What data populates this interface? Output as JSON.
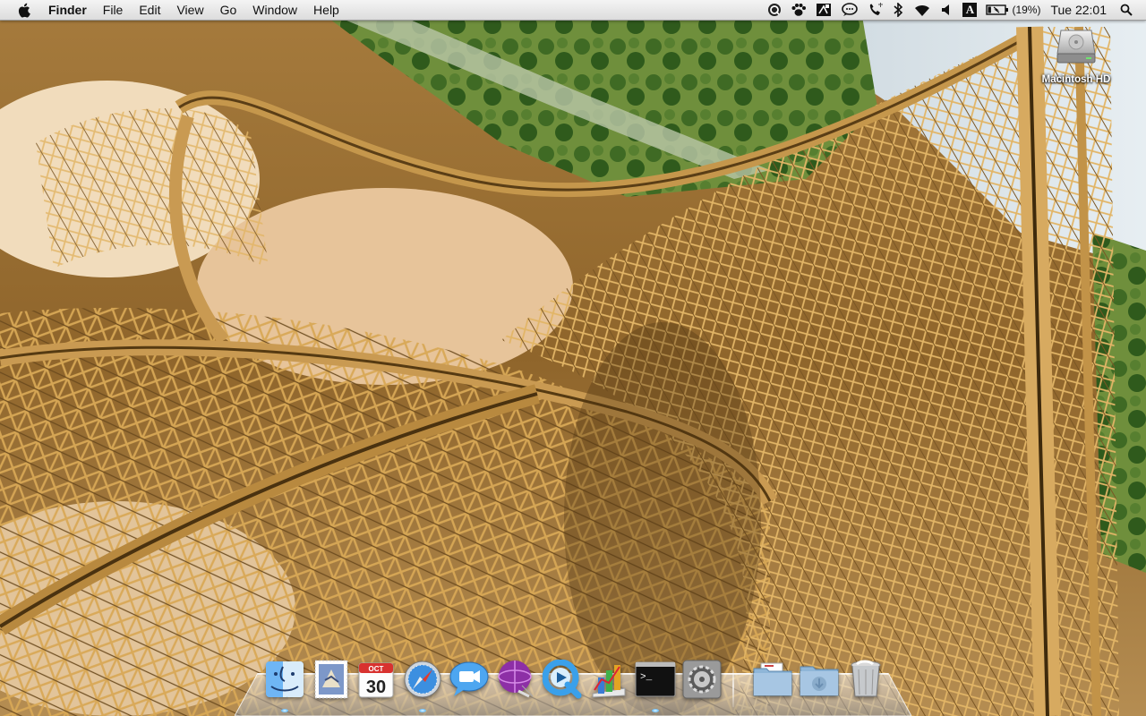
{
  "menubar": {
    "apple_icon": "apple-logo-icon",
    "app_name": "Finder",
    "menus": [
      "File",
      "Edit",
      "View",
      "Go",
      "Window",
      "Help"
    ],
    "status_icons": [
      "quicksilver-icon",
      "growl-paw-icon",
      "ink-icon",
      "chat-bubble-icon",
      "phone-icon",
      "bluetooth-icon",
      "wifi-icon",
      "volume-icon",
      "input-source-icon"
    ],
    "input_source_letter": "A",
    "battery": {
      "icon": "battery-icon",
      "percent_label": "(19%)",
      "level": 0.19
    },
    "clock": "Tue 22:01",
    "spotlight_icon": "spotlight-search-icon"
  },
  "desktop": {
    "wallpaper": "wooden-rollercoaster-photo",
    "icons": [
      {
        "label": "Macintosh HD",
        "icon": "hard-drive-icon"
      }
    ]
  },
  "dock": {
    "apps": [
      {
        "name": "Finder",
        "icon": "finder-icon",
        "running": true
      },
      {
        "name": "Mail",
        "icon": "mail-stamp-icon",
        "running": false
      },
      {
        "name": "iCal",
        "icon": "ical-calendar-icon",
        "running": false,
        "month": "OCT",
        "day": "30"
      },
      {
        "name": "Safari",
        "icon": "safari-compass-icon",
        "running": true
      },
      {
        "name": "iChat",
        "icon": "ichat-video-icon",
        "running": false
      },
      {
        "name": "Adium",
        "icon": "purple-globe-icon",
        "running": false
      },
      {
        "name": "QuickTime Player",
        "icon": "quicktime-icon",
        "running": false
      },
      {
        "name": "Activity Monitor",
        "icon": "chart-icon",
        "running": false
      },
      {
        "name": "Terminal",
        "icon": "terminal-icon",
        "running": true,
        "prompt": ">_"
      },
      {
        "name": "System Preferences",
        "icon": "gear-icon",
        "running": false
      }
    ],
    "stacks": [
      {
        "name": "Documents",
        "icon": "documents-folder-icon"
      },
      {
        "name": "Downloads",
        "icon": "downloads-folder-icon"
      },
      {
        "name": "Trash",
        "icon": "trash-icon"
      }
    ]
  },
  "colors": {
    "menubar_top": "#f4f4f4",
    "menubar_bottom": "#dcdcdc",
    "running_indicator": "#6fc3ff",
    "wood": "#b98a3e"
  }
}
